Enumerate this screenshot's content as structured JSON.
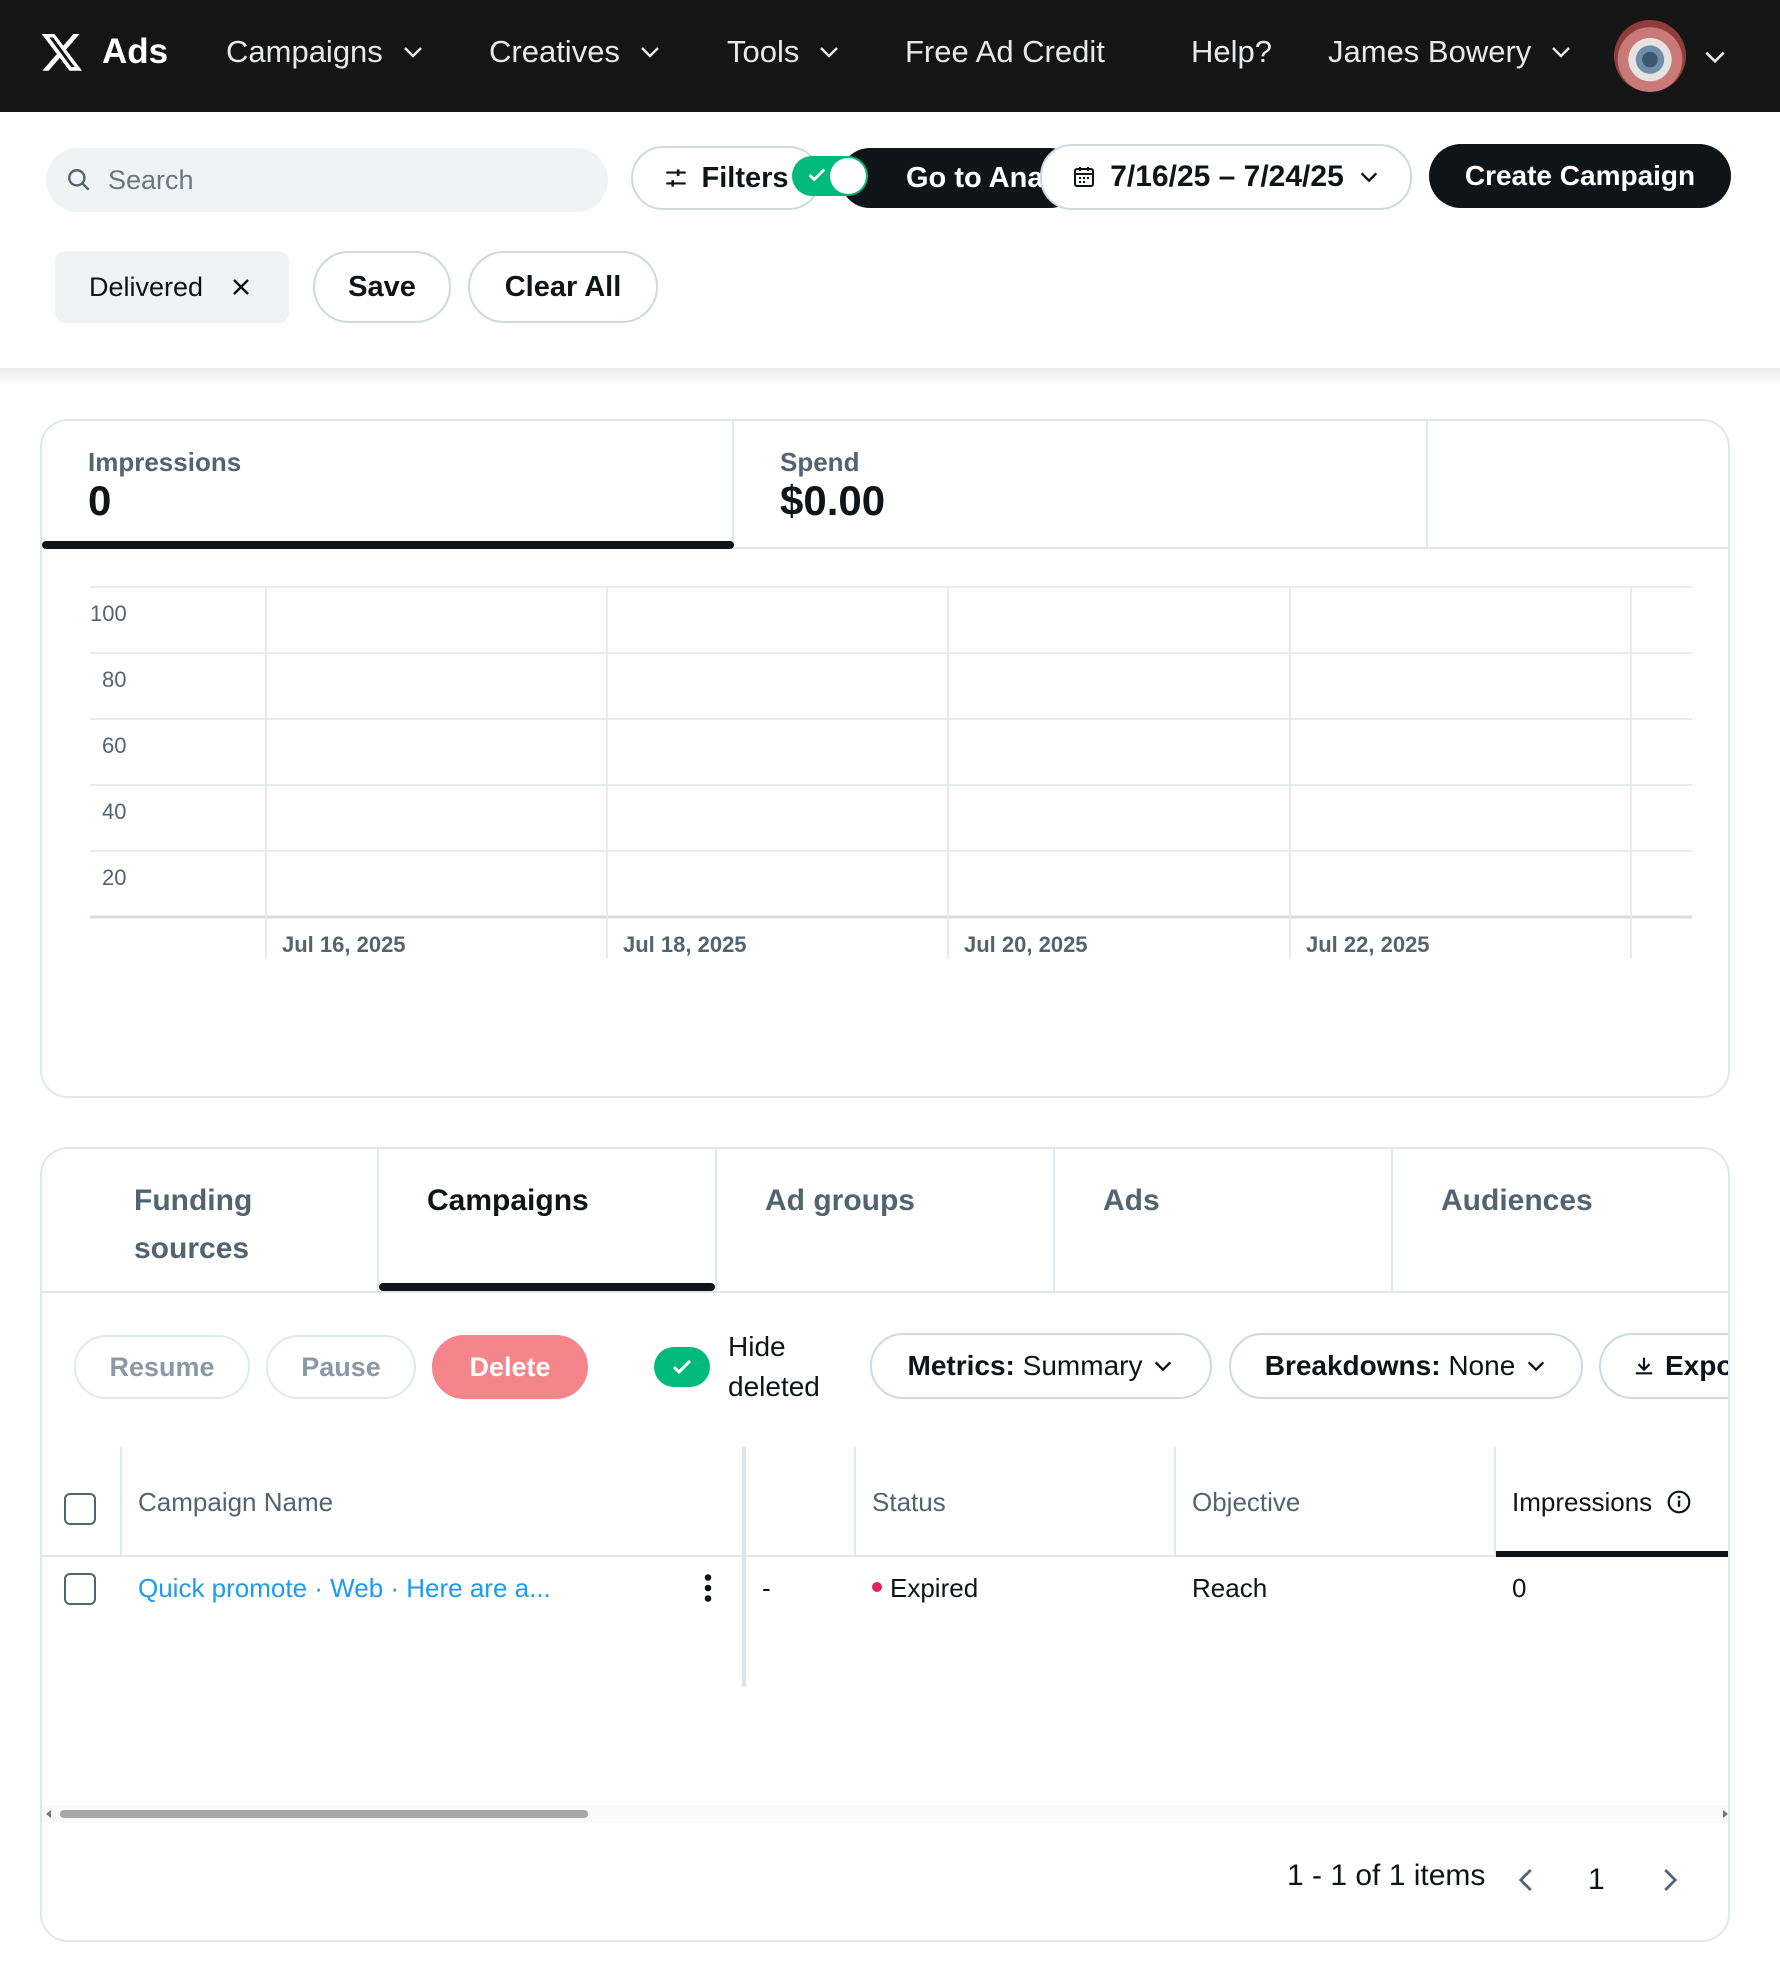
{
  "nav": {
    "brand": "Ads",
    "items": [
      {
        "label": "Campaigns"
      },
      {
        "label": "Creatives"
      },
      {
        "label": "Tools"
      },
      {
        "label": "Free Ad Credit"
      },
      {
        "label": "Help?"
      },
      {
        "label": "James Bowery"
      }
    ]
  },
  "toolbar": {
    "search_placeholder": "Search",
    "filters_label": "Filters",
    "analytics_label": "Go to Analytics",
    "date_range": "7/16/25 – 7/24/25",
    "create_label": "Create Campaign"
  },
  "filter_bar": {
    "chip": "Delivered",
    "save_label": "Save",
    "clear_label": "Clear All"
  },
  "metrics": [
    {
      "label": "Impressions",
      "value": "0"
    },
    {
      "label": "Spend",
      "value": "$0.00"
    }
  ],
  "chart_data": {
    "type": "line",
    "title": "",
    "xlabel": "",
    "ylabel": "",
    "x_ticks": [
      "Jul 16, 2025",
      "Jul 18, 2025",
      "Jul 20, 2025",
      "Jul 22, 2025"
    ],
    "y_ticks": [
      "100",
      "80",
      "60",
      "40",
      "20"
    ],
    "ylim": [
      0,
      100
    ],
    "grid": true,
    "series": []
  },
  "tabs": [
    {
      "label": "Funding sources"
    },
    {
      "label": "Campaigns"
    },
    {
      "label": "Ad groups"
    },
    {
      "label": "Ads"
    },
    {
      "label": "Audiences"
    }
  ],
  "actions": {
    "resume": "Resume",
    "pause": "Pause",
    "delete": "Delete",
    "hide_deleted": "Hide deleted",
    "metrics_key": "Metrics:",
    "metrics_value": "Summary",
    "breakdowns_key": "Breakdowns:",
    "breakdowns_value": "None",
    "export": "Export"
  },
  "table": {
    "headers": [
      "Campaign Name",
      "",
      "Status",
      "Objective",
      "Impressions"
    ],
    "rows": [
      {
        "name": "Quick promote · Web · Here are a...",
        "col2": "-",
        "status": "Expired",
        "objective": "Reach",
        "impressions": "0"
      }
    ]
  },
  "pagination": {
    "summary": "1 - 1 of 1 items",
    "page": "1"
  },
  "colors": {
    "nav_bg": "#151515",
    "accent_green": "#00ba7c",
    "link_blue": "#1d9bf0",
    "delete_red": "#f4858a",
    "status_red": "#e0245e"
  }
}
